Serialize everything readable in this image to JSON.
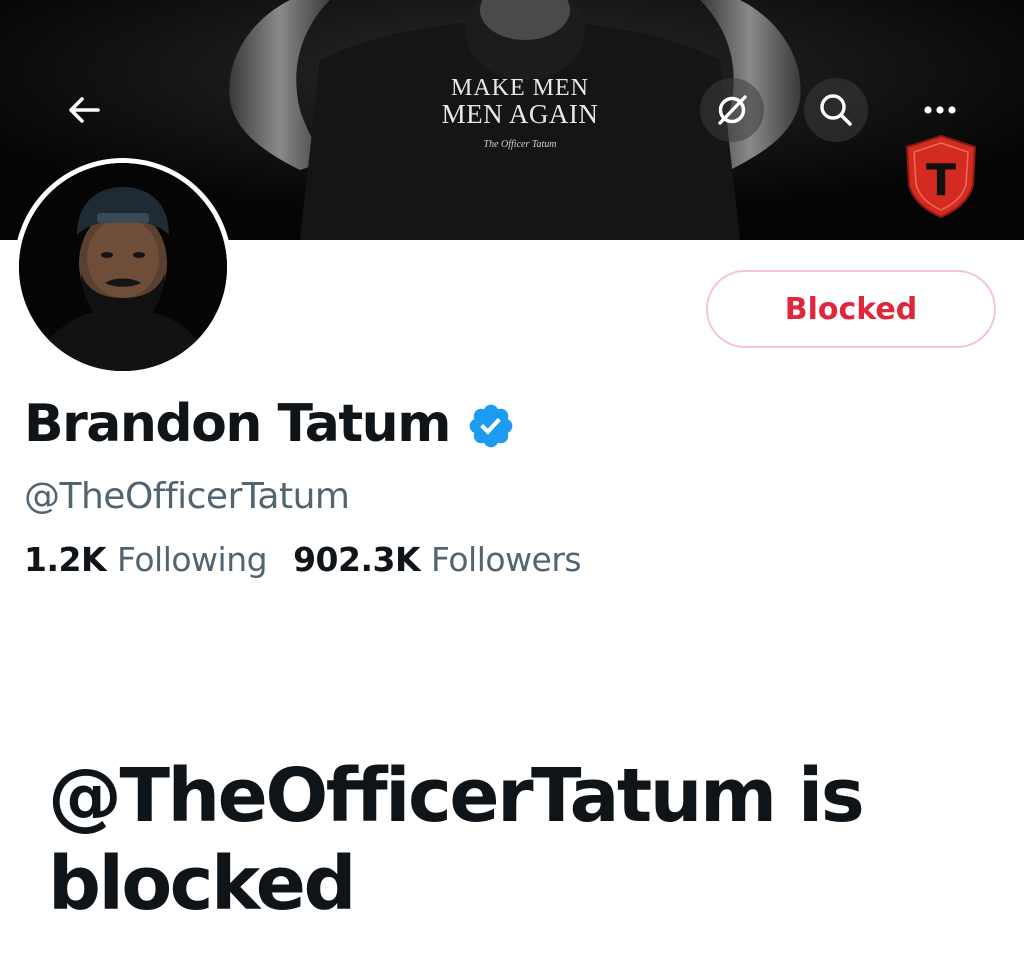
{
  "banner": {
    "shirt_line1": "MAKE MEN",
    "shirt_line2": "MEN AGAIN",
    "shirt_signature": "The Officer Tatum",
    "shield_letter": "T"
  },
  "header": {
    "back_icon": "arrow-left-icon",
    "quiet_icon": "notifications-off-icon",
    "search_icon": "search-icon",
    "more_icon": "more-horizontal-icon"
  },
  "profile": {
    "display_name": "Brandon Tatum",
    "handle": "@TheOfficerTatum",
    "verified": true,
    "following_count": "1.2K",
    "following_label": "Following",
    "followers_count": "902.3K",
    "followers_label": "Followers"
  },
  "actions": {
    "blocked_label": "Blocked"
  },
  "blocked_notice": {
    "title": "@TheOfficerTatum is blocked"
  },
  "colors": {
    "blocked_red": "#e0263a",
    "verified_blue": "#1d9bf0",
    "secondary_text": "#536471",
    "primary_text": "#0f1419"
  }
}
